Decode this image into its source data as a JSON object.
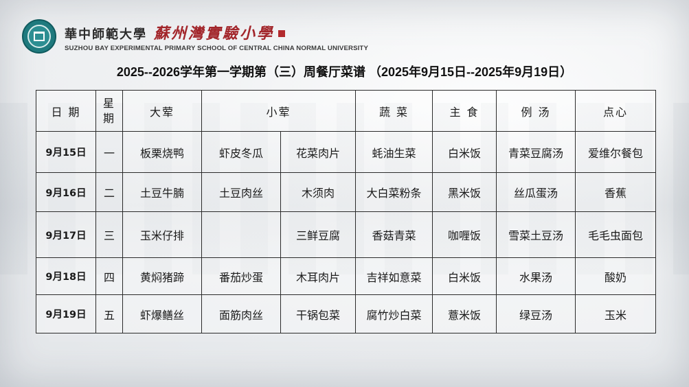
{
  "header": {
    "cn_university": "華中師範大學",
    "cn_school": "蘇州灣實驗小學",
    "en_name": "SUZHOU BAY EXPERIMENTAL PRIMARY SCHOOL OF CENTRAL CHINA NORMAL UNIVERSITY"
  },
  "title": "2025--2026学年第一学期第（三）周餐厅菜谱 （2025年9月15日--2025年9月19日）",
  "table": {
    "headers": {
      "date": "日 期",
      "weekday_line1": "星",
      "weekday_line2": "期",
      "main": "大荤",
      "small": "小荤",
      "veg": "蔬 菜",
      "staple": "主 食",
      "soup": "例 汤",
      "snack": "点心"
    },
    "rows": [
      {
        "date": "9月15日",
        "weekday": "一",
        "main": "板栗烧鸭",
        "small1": "虾皮冬瓜",
        "small2": "花菜肉片",
        "veg": "蚝油生菜",
        "staple": "白米饭",
        "soup": "青菜豆腐汤",
        "snack": "爱维尔餐包"
      },
      {
        "date": "9月16日",
        "weekday": "二",
        "main": "土豆牛腩",
        "small1": "土豆肉丝",
        "small2": "木须肉",
        "veg": "大白菜粉条",
        "staple": "黑米饭",
        "soup": "丝瓜蛋汤",
        "snack": "香蕉"
      },
      {
        "date": "9月17日",
        "weekday": "三",
        "main": "玉米仔排",
        "small1": "",
        "small2": "三鲜豆腐",
        "veg": "香菇青菜",
        "staple": "咖喱饭",
        "soup": "雪菜土豆汤",
        "snack": "毛毛虫面包"
      },
      {
        "date": "9月18日",
        "weekday": "四",
        "main": "黄焖猪蹄",
        "small1": "番茄炒蛋",
        "small2": "木耳肉片",
        "veg": "吉祥如意菜",
        "staple": "白米饭",
        "soup": "水果汤",
        "snack": "酸奶"
      },
      {
        "date": "9月19日",
        "weekday": "五",
        "main": "虾爆鳝丝",
        "small1": "面筋肉丝",
        "small2": "干锅包菜",
        "veg": "腐竹炒白菜",
        "staple": "薏米饭",
        "soup": "绿豆汤",
        "snack": "玉米"
      }
    ]
  }
}
